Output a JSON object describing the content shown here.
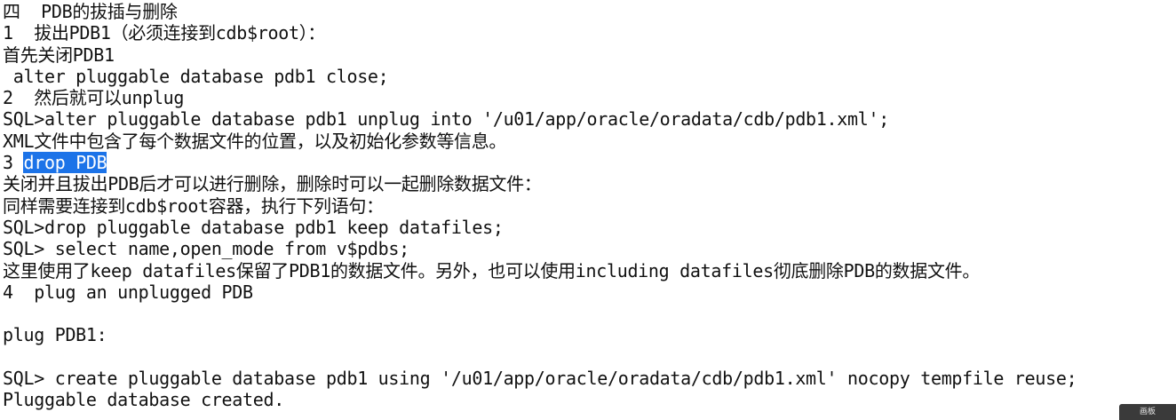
{
  "document": {
    "lines": [
      "四  PDB的拔插与删除",
      "1  拔出PDB1（必须连接到cdb$root）：",
      "首先关闭PDB1",
      " alter pluggable database pdb1 close;",
      "2  然后就可以unplug",
      "SQL>alter pluggable database pdb1 unplug into '/u01/app/oracle/oradata/cdb/pdb1.xml';",
      "XML文件中包含了每个数据文件的位置，以及初始化参数等信息。",
      "",
      "关闭并且拔出PDB后才可以进行删除，删除时可以一起删除数据文件：",
      "同样需要连接到cdb$root容器，执行下列语句：",
      "SQL>drop pluggable database pdb1 keep datafiles;",
      "SQL> select name,open_mode from v$pdbs;",
      "这里使用了keep datafiles保留了PDB1的数据文件。另外，也可以使用including datafiles彻底删除PDB的数据文件。",
      "4  plug an unplugged PDB",
      "",
      "plug PDB1:",
      "",
      "SQL> create pluggable database pdb1 using '/u01/app/oracle/oradata/cdb/pdb1.xml' nocopy tempfile reuse;",
      "Pluggable database created."
    ],
    "section3_prefix": "3 ",
    "section3_selected": "drop PDB"
  },
  "overlay": {
    "pager_label": "画板"
  }
}
